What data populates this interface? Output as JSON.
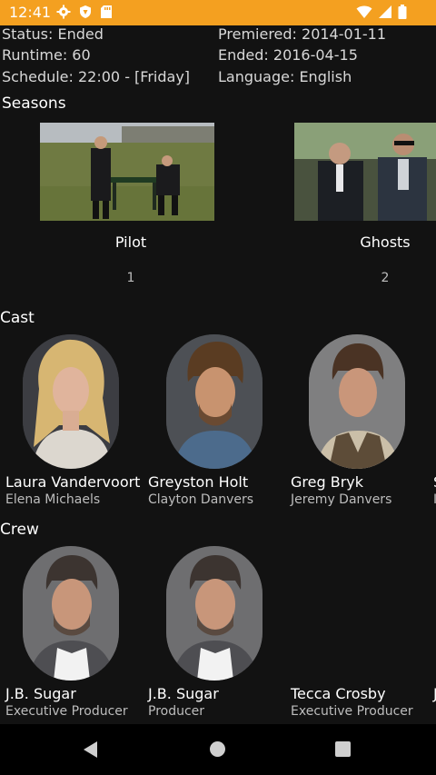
{
  "status_bar": {
    "time": "12:41",
    "icons_left": [
      "gear-icon",
      "shield-icon",
      "sdcard-icon"
    ],
    "icons_right": [
      "wifi-icon",
      "signal-icon",
      "battery-icon"
    ]
  },
  "show_info": {
    "status": "Status: Ended",
    "runtime": "Runtime: 60",
    "schedule": "Schedule: 22:00 - [Friday]",
    "premiered": "Premiered: 2014-01-11",
    "ended": "Ended: 2016-04-15",
    "language": "Language: English"
  },
  "seasons": {
    "title": "Seasons",
    "items": [
      {
        "name": "Pilot",
        "number": "1"
      },
      {
        "name": "Ghosts",
        "number": "2"
      }
    ]
  },
  "cast": {
    "title": "Cast",
    "items": [
      {
        "name": "Laura Vandervoort",
        "role": "Elena Michaels"
      },
      {
        "name": "Greyston Holt",
        "role": "Clayton Danvers"
      },
      {
        "name": "Greg Bryk",
        "role": "Jeremy Danvers"
      },
      {
        "name": "S",
        "role": "I"
      }
    ]
  },
  "crew": {
    "title": "Crew",
    "items": [
      {
        "name": "J.B. Sugar",
        "role": "Executive Producer"
      },
      {
        "name": "J.B. Sugar",
        "role": "Producer"
      },
      {
        "name": "Tecca Crosby",
        "role": "Executive Producer"
      },
      {
        "name": "J",
        "role": ""
      }
    ]
  },
  "nav_bar": {
    "buttons": [
      "back-icon",
      "home-icon",
      "recents-icon"
    ]
  }
}
